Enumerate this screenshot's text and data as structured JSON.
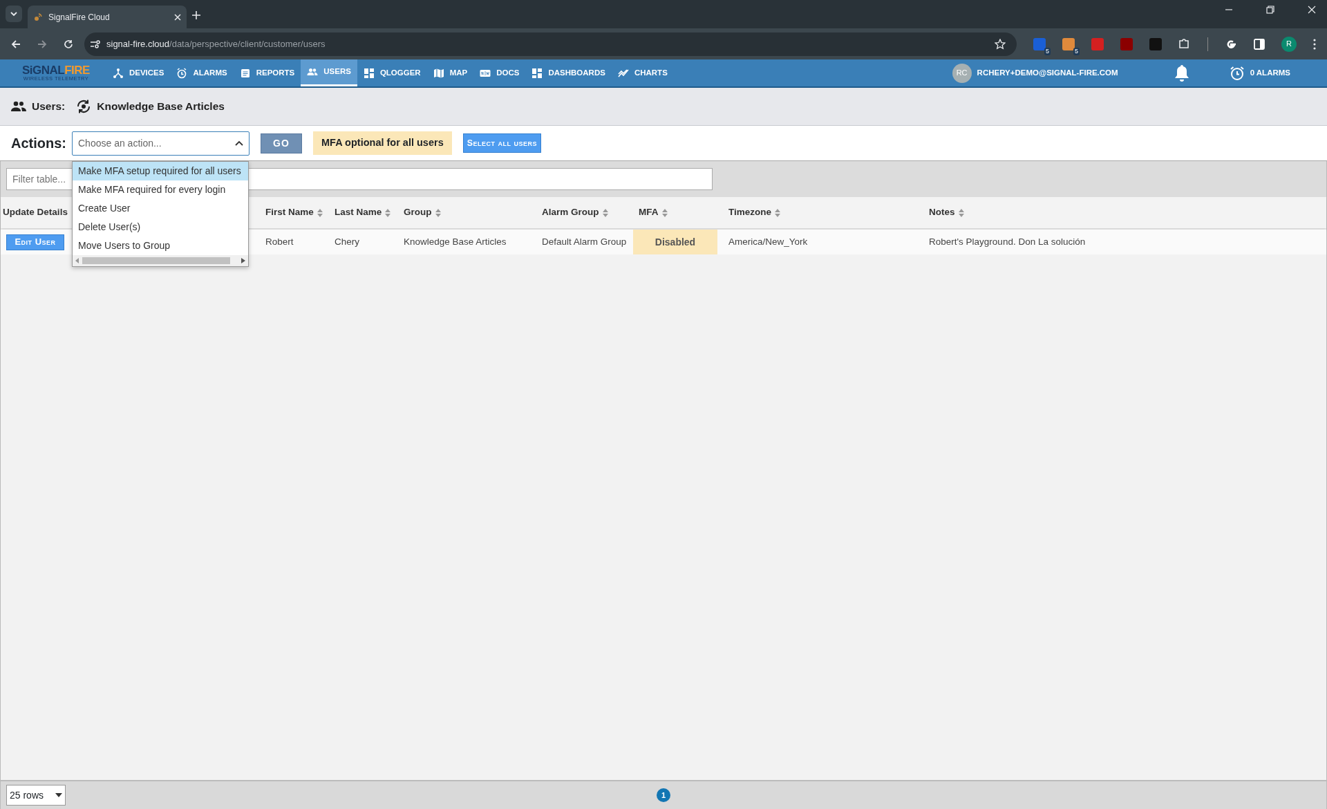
{
  "browser": {
    "tab_title": "SignalFire Cloud",
    "url_domain": "signal-fire.cloud",
    "url_path": "/data/perspective/client/customer/users",
    "extensions": [
      {
        "kind": "shield",
        "color": "#1a5fd6",
        "count": "5"
      },
      {
        "kind": "grid",
        "color": "#e08a3c",
        "count": "5"
      },
      {
        "kind": "wand",
        "color": "#d42020"
      },
      {
        "kind": "ublock",
        "color": "#8b0000"
      },
      {
        "kind": "letter",
        "color": "#111111"
      },
      {
        "kind": "puzzle"
      }
    ],
    "profile": "R"
  },
  "navbar": {
    "logo": {
      "word_1": "SiGNAL",
      "word_2": "FIRE",
      "tagline": "WIRELESS TELEMETRY"
    },
    "items": [
      {
        "label": "DEVICES",
        "selected": false
      },
      {
        "label": "ALARMS",
        "selected": false
      },
      {
        "label": "REPORTS",
        "selected": false
      },
      {
        "label": "USERS",
        "selected": true
      },
      {
        "label": "QLOGGER",
        "selected": false
      },
      {
        "label": "MAP",
        "selected": false
      },
      {
        "label": "DOCS",
        "selected": false
      },
      {
        "label": "DASHBOARDS",
        "selected": false
      },
      {
        "label": "CHARTS",
        "selected": false
      }
    ],
    "user_initials": "RC",
    "user_email": "RCHERY+DEMO@SIGNAL-FIRE.COM",
    "alarms": "0 ALARMS"
  },
  "breadcrumb": {
    "label": "Users:",
    "group": "Knowledge Base Articles"
  },
  "actions": {
    "label": "Actions:",
    "placeholder": "Choose an action...",
    "expanded": true,
    "options": [
      {
        "label": "Make MFA setup required for all users",
        "selected": true
      },
      {
        "label": "Make MFA required for every login",
        "selected": false
      },
      {
        "label": "Create User",
        "selected": false
      },
      {
        "label": "Delete User(s)",
        "selected": false
      },
      {
        "label": "Move Users to Group",
        "selected": false
      }
    ],
    "go": "GO",
    "mfa_note": "MFA optional for all users",
    "select_all": "Select all users"
  },
  "filter": {
    "placeholder": "Filter table..."
  },
  "table": {
    "columns": [
      {
        "label": "Update Details",
        "sortable": false
      },
      {
        "label": "First Name",
        "sortable": true
      },
      {
        "label": "Last Name",
        "sortable": true
      },
      {
        "label": "Group",
        "sortable": true
      },
      {
        "label": "Alarm Group",
        "sortable": true
      },
      {
        "label": "MFA",
        "sortable": true
      },
      {
        "label": "Timezone",
        "sortable": true
      },
      {
        "label": "Notes",
        "sortable": true
      }
    ],
    "rows": [
      {
        "edit": "Edit User",
        "first_name": "Robert",
        "last_name": "Chery",
        "group": "Knowledge Base Articles",
        "alarm_group": "Default Alarm Group",
        "mfa": "Disabled",
        "timezone": "America/New_York",
        "notes": "Robert's Playground. Don La solución"
      }
    ]
  },
  "footer": {
    "rows_per_page": "25 rows",
    "pages": [
      {
        "label": "1",
        "selected": true
      }
    ]
  }
}
